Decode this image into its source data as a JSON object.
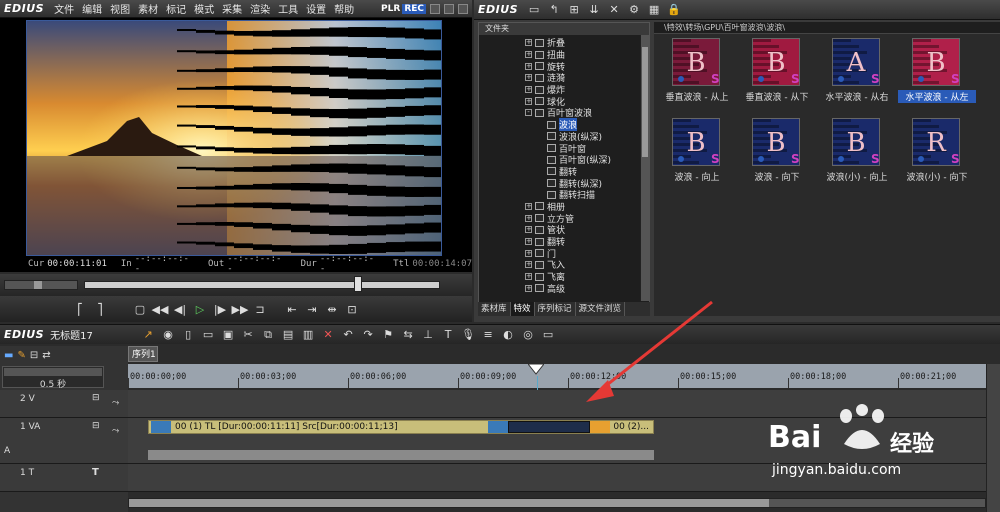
{
  "app": {
    "logo": "EDIUS"
  },
  "menu": [
    "文件",
    "编辑",
    "视图",
    "素材",
    "标记",
    "模式",
    "采集",
    "渲染",
    "工具",
    "设置",
    "帮助"
  ],
  "plr": {
    "plr": "PLR",
    "rec": "REC"
  },
  "timecodes": {
    "cur_label": "Cur",
    "cur": "00:00:11:01",
    "in_label": "In",
    "in": "--:--:--:--",
    "out_label": "Out",
    "out": "--:--:--:--",
    "dur_label": "Dur",
    "dur": "--:--:--:--",
    "ttl_label": "Ttl",
    "ttl": "00:00:14:07"
  },
  "folder_panel": {
    "header": "文件夹"
  },
  "tree": [
    {
      "label": "折叠",
      "expander": "+",
      "indent": 0
    },
    {
      "label": "扭曲",
      "expander": "+",
      "indent": 0
    },
    {
      "label": "旋转",
      "expander": "+",
      "indent": 0
    },
    {
      "label": "涟漪",
      "expander": "+",
      "indent": 0
    },
    {
      "label": "爆炸",
      "expander": "+",
      "indent": 0
    },
    {
      "label": "球化",
      "expander": "+",
      "indent": 0
    },
    {
      "label": "百叶窗波浪",
      "expander": "-",
      "indent": 0
    },
    {
      "label": "波浪",
      "expander": "",
      "indent": 1,
      "selected": true
    },
    {
      "label": "波浪(纵深)",
      "expander": "",
      "indent": 1
    },
    {
      "label": "百叶窗",
      "expander": "",
      "indent": 1
    },
    {
      "label": "百叶窗(纵深)",
      "expander": "",
      "indent": 1
    },
    {
      "label": "翻转",
      "expander": "",
      "indent": 1
    },
    {
      "label": "翻转(纵深)",
      "expander": "",
      "indent": 1
    },
    {
      "label": "翻转扫描",
      "expander": "",
      "indent": 1
    },
    {
      "label": "相册",
      "expander": "+",
      "indent": 0
    },
    {
      "label": "立方管",
      "expander": "+",
      "indent": 0
    },
    {
      "label": "管状",
      "expander": "+",
      "indent": 0
    },
    {
      "label": "翻转",
      "expander": "+",
      "indent": 0
    },
    {
      "label": "门",
      "expander": "+",
      "indent": 0
    },
    {
      "label": "飞入",
      "expander": "+",
      "indent": 0
    },
    {
      "label": "飞离",
      "expander": "+",
      "indent": 0
    },
    {
      "label": "高级",
      "expander": "+",
      "indent": 0
    }
  ],
  "tabs": [
    "素材库",
    "特效",
    "序列标记",
    "源文件浏览"
  ],
  "path": "\\特效\\转场\\GPU\\百叶窗波浪\\波浪\\",
  "thumbnails": [
    {
      "label": "垂直波浪 - 从上",
      "selected": false,
      "color": "#7a1a3a",
      "letter": "B"
    },
    {
      "label": "垂直波浪 - 从下",
      "selected": false,
      "color": "#a01a40",
      "letter": "B"
    },
    {
      "label": "水平波浪 - 从右",
      "selected": false,
      "color": "#1a2a6a",
      "letter": "A"
    },
    {
      "label": "水平波浪 - 从左",
      "selected": true,
      "color": "#b0204a",
      "letter": "B"
    },
    {
      "label": "波浪 - 向上",
      "selected": false,
      "color": "#1a2a6a",
      "letter": "B"
    },
    {
      "label": "波浪 - 向下",
      "selected": false,
      "color": "#1a2a6a",
      "letter": "B"
    },
    {
      "label": "波浪(小) - 向上",
      "selected": false,
      "color": "#1a2a6a",
      "letter": "B"
    },
    {
      "label": "波浪(小) - 向下",
      "selected": false,
      "color": "#1a2a6a",
      "letter": "R"
    }
  ],
  "timeline": {
    "logo": "EDIUS",
    "project": "无标题17",
    "sequence_tab": "序列1",
    "zoom": "0.5 秒",
    "ruler_ticks": [
      "00:00:00;00",
      "00:00:03;00",
      "00:00:06;00",
      "00:00:09;00",
      "00:00:12;00",
      "00:00:15;00",
      "00:00:18;00",
      "00:00:21;00"
    ],
    "tracks": [
      {
        "name": "2 V",
        "kind": "video"
      },
      {
        "name": "1 VA",
        "kind": "va"
      },
      {
        "name": "1 T",
        "kind": "title"
      }
    ],
    "clip1": "00 (1)  TL [Dur:00:00:11:11]  Src[Dur:00:00:11;13]",
    "clip2": "00 (2)..."
  },
  "watermark": {
    "brand": "Bai",
    "brand2": "经验",
    "url": "jingyan.baidu.com"
  },
  "colors": {
    "accent": "#2a5bb8",
    "clip": "#c8be7a",
    "arrow": "#e53935"
  }
}
